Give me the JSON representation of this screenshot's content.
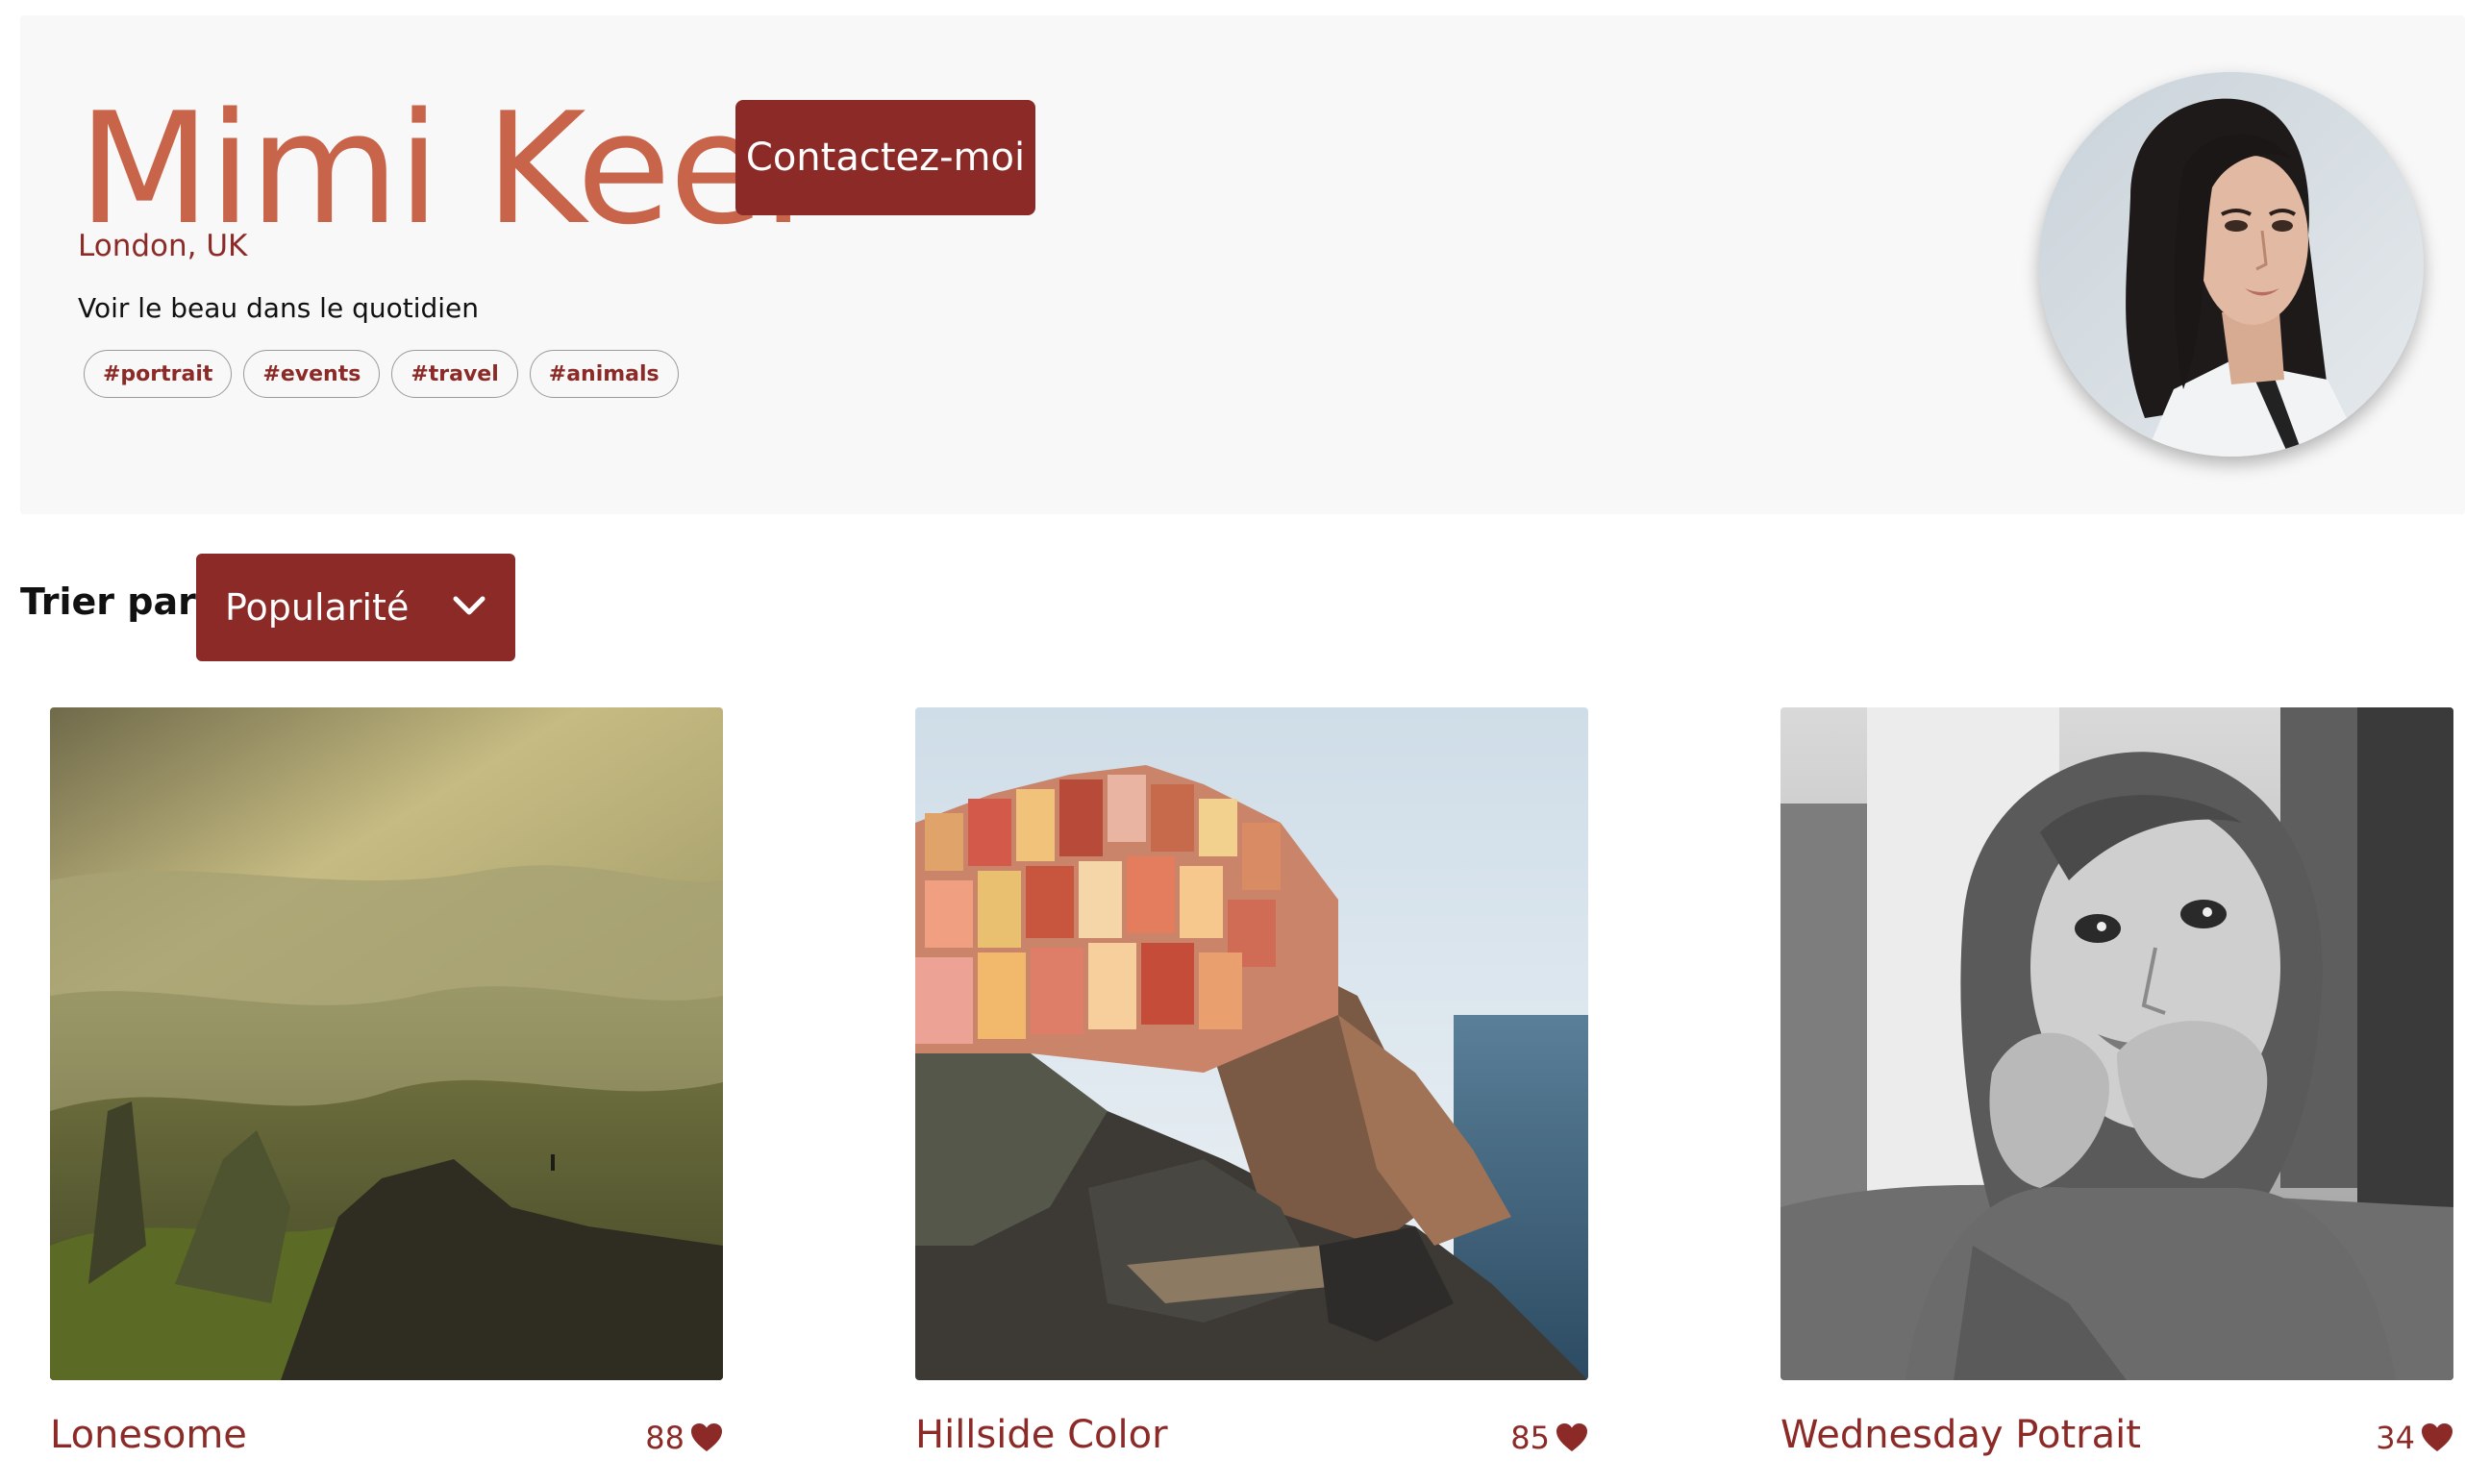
{
  "profile": {
    "name": "Mimi Keel",
    "location": "London, UK",
    "bio": "Voir le beau dans le quotidien",
    "contact_label": "Contactez-moi",
    "tags": [
      "#portrait",
      "#events",
      "#travel",
      "#animals"
    ]
  },
  "sort": {
    "label": "Trier par",
    "selected": "Popularité",
    "icon": "chevron-down-icon"
  },
  "photos": [
    {
      "title": "Lonesome",
      "likes": "88",
      "icon": "heart-icon"
    },
    {
      "title": "Hillside Color",
      "likes": "85",
      "icon": "heart-icon"
    },
    {
      "title": "Wednesday Potrait",
      "likes": "34",
      "icon": "heart-icon"
    }
  ],
  "colors": {
    "accent": "#8b2a27",
    "name": "#c86449",
    "header_bg": "#f8f8f8"
  }
}
